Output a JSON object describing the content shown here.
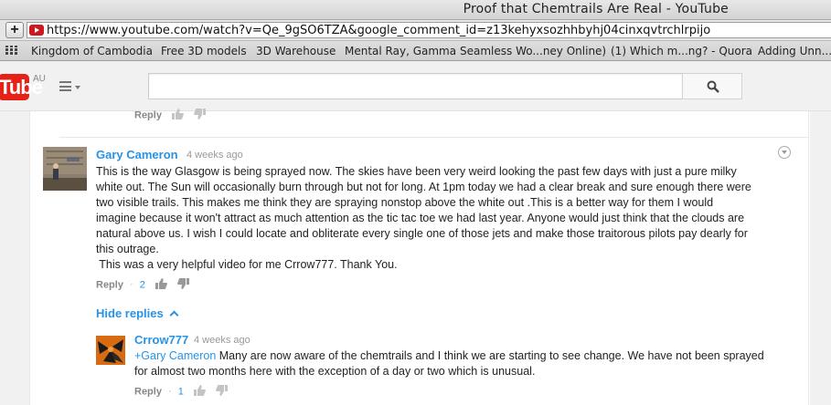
{
  "window": {
    "title": "Proof that Chemtrails Are Real - YouTube"
  },
  "browser": {
    "new_tab_label": "+",
    "url": "https://www.youtube.com/watch?v=Qe_9gSO6TZA&google_comment_id=z13kehyxsozhhbyhj04cinxqvtrchlrpijo",
    "bookmarks": [
      "Kingdom of Cambodia",
      "Free 3D models",
      "3D Warehouse",
      "Mental Ray, Gamma",
      "Seamless Wo...ney Online)",
      "(1) Which m...ng? - Quora",
      "Adding Unn..."
    ]
  },
  "header": {
    "logo_text": "Tube",
    "country": "AU",
    "search_value": ""
  },
  "previous": {
    "reply_label": "Reply"
  },
  "comment": {
    "author": "Gary Cameron",
    "time": "4 weeks ago",
    "text_lines": [
      "This is the way Glasgow is being sprayed now. The skies have been very weird looking the past few days with just a pure milky",
      "white out. The Sun will occasionally burn through but not for long. At 1pm today we had a clear break and sure enough there were",
      "two visible trails. This makes me think they are spraying nonstop above the white out .This is a better way for them I would",
      "imagine because it won't attract as much attention as the tic tac toe we had last year. Anyone would just think that the clouds are",
      "natural above us. I wish I could locate and obliterate every single one of those jets and make those traitorous pilots pay dearly for",
      "this outrage.",
      " This was a very helpful video for me Crrow777. Thank You."
    ],
    "reply_label": "Reply",
    "separator": "·",
    "like_count": "2"
  },
  "replies_toggle": {
    "label": "Hide replies"
  },
  "reply": {
    "author": "Crrow777",
    "time": "4 weeks ago",
    "mention": "+Gary Cameron",
    "text_first": " Many are now aware of the chemtrails and I think we are starting to see change. We have not been sprayed",
    "text_second": "for almost two months here with the exception of a day or two which is unusual.",
    "reply_label": "Reply",
    "separator": "·",
    "like_count": "1"
  },
  "colors": {
    "link_blue": "#2793e6",
    "youtube_red": "#e62117",
    "meta_gray": "#999999"
  },
  "icons": [
    "plus-icon",
    "youtube-favicon",
    "bookmarks-grid-icon",
    "menu-icon",
    "search-icon",
    "thumbs-up-icon",
    "thumbs-down-icon",
    "options-chevron-icon",
    "chevron-up-icon"
  ]
}
